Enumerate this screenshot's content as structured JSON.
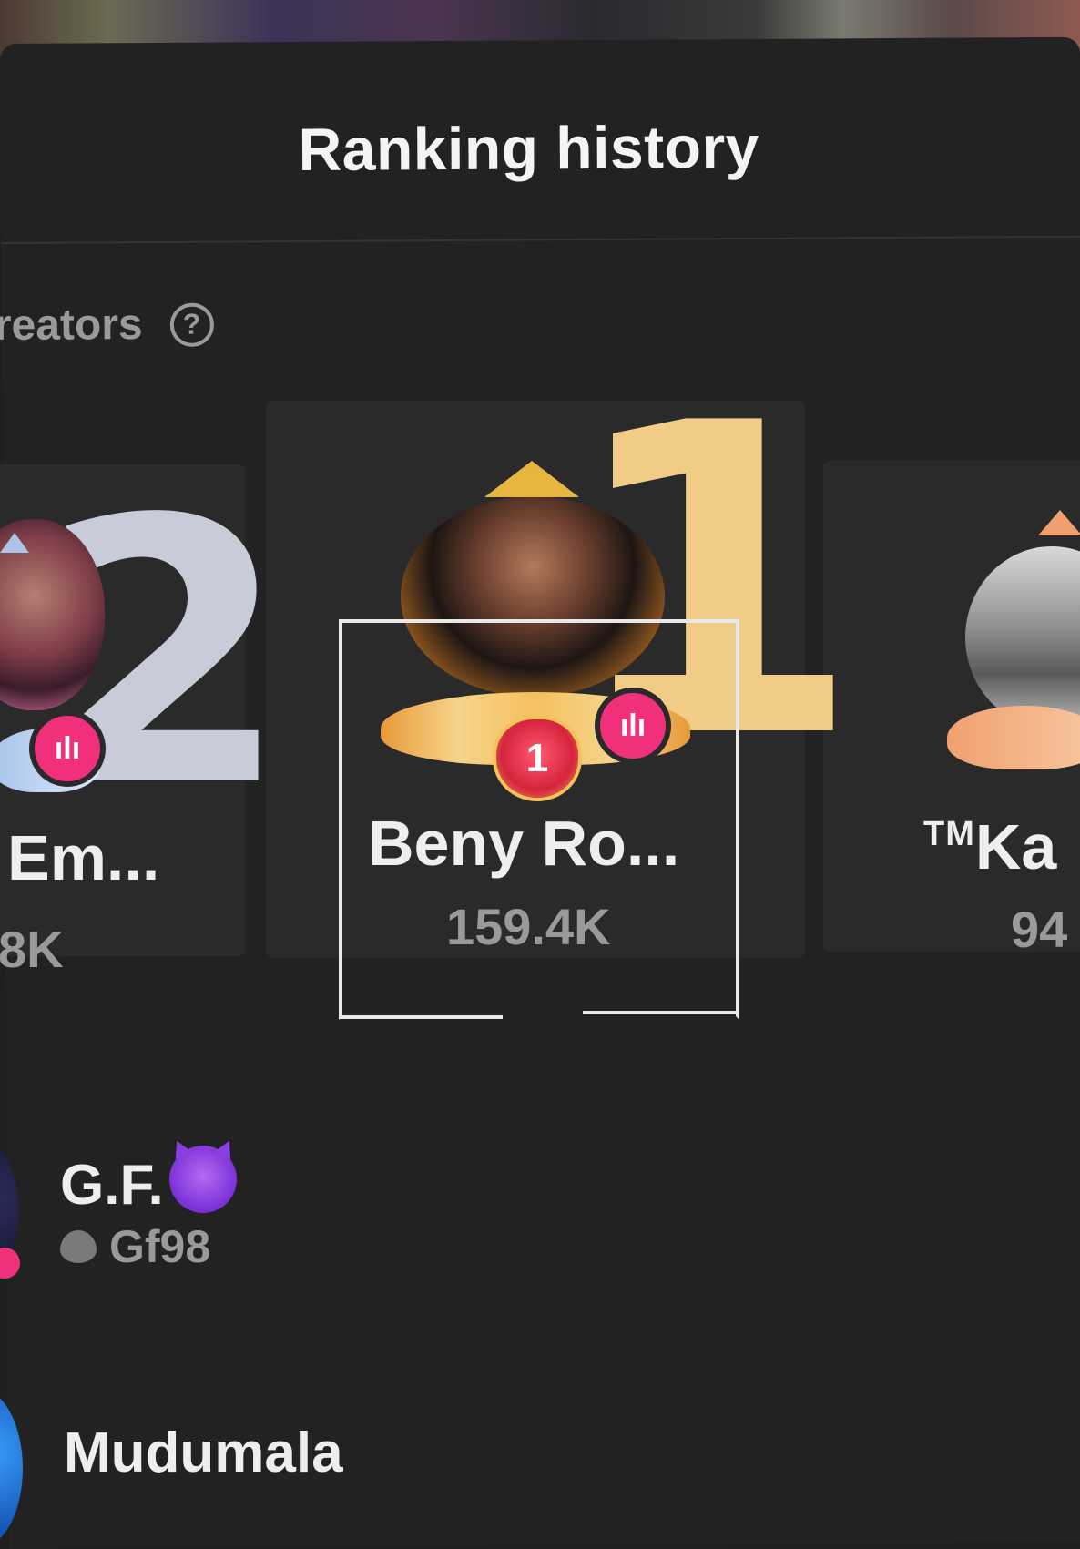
{
  "header": {
    "title": "Ranking history"
  },
  "section": {
    "label": "reators",
    "help_icon": "question-circle-icon"
  },
  "podium": {
    "first": {
      "rank": "1",
      "name": "Beny Ro...",
      "score": "159.4K",
      "badge_rank": "1",
      "live_badge": "ılı"
    },
    "second": {
      "rank": "2",
      "name": "Em...",
      "score": "8K",
      "live_badge": "ılı"
    },
    "third": {
      "tm": "TM",
      "name": "Ka",
      "score": "94"
    }
  },
  "list": {
    "items": [
      {
        "name": "G.F.",
        "fan_club": "Gf98"
      },
      {
        "name": "Mudumala"
      }
    ]
  },
  "colors": {
    "background": "#222222",
    "gold": "#f0cc86",
    "silver": "#c7ccd8",
    "live_pink": "#f0307a"
  }
}
